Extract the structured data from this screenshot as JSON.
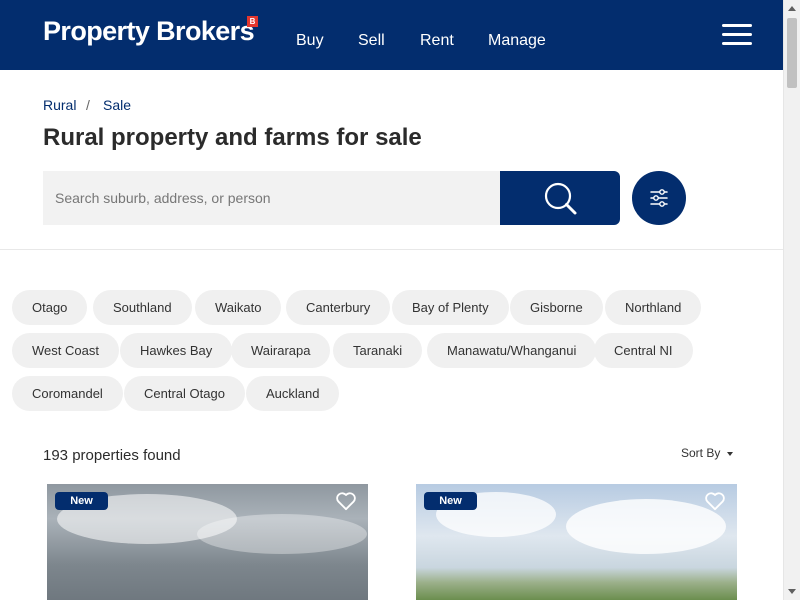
{
  "header": {
    "logo_text": "Property Brokers",
    "logo_badge": "B",
    "nav": [
      "Buy",
      "Sell",
      "Rent",
      "Manage"
    ],
    "menu_icon": "hamburger-menu-icon"
  },
  "breadcrumb": {
    "items": [
      "Rural",
      "Sale"
    ],
    "separator": "/"
  },
  "page_title": "Rural property and farms for sale",
  "search": {
    "placeholder": "Search suburb, address, or person",
    "button_icon": "search-icon",
    "filter_icon": "filter-sliders-icon"
  },
  "regions": [
    "Otago",
    "Southland",
    "Waikato",
    "Canterbury",
    "Bay of Plenty",
    "Gisborne",
    "Northland",
    "West Coast",
    "Hawkes Bay",
    "Wairarapa",
    "Taranaki",
    "Manawatu/Whanganui",
    "Central NI",
    "Coromandel",
    "Central Otago",
    "Auckland"
  ],
  "results": {
    "count_text": "193 properties found",
    "sort_label": "Sort By"
  },
  "listings": [
    {
      "badge": "New",
      "favorite_icon": "heart-icon"
    },
    {
      "badge": "New",
      "favorite_icon": "heart-icon"
    }
  ],
  "colors": {
    "brand_navy": "#032d6e",
    "logo_badge_red": "#e3372f",
    "chip_background": "#f0f0f0"
  }
}
